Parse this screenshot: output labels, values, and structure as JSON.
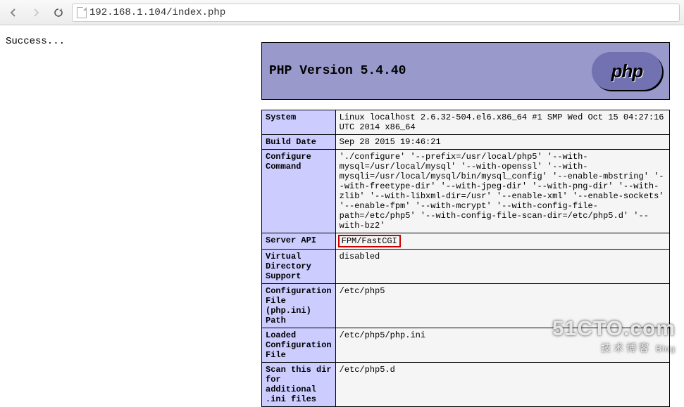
{
  "browser": {
    "url": "192.168.1.104/index.php"
  },
  "page": {
    "success_text": "Success..."
  },
  "phpinfo": {
    "title": "PHP Version 5.4.40",
    "logo_text": "php",
    "rows": [
      {
        "key": "System",
        "value": "Linux localhost 2.6.32-504.el6.x86_64 #1 SMP Wed Oct 15 04:27:16 UTC 2014 x86_64"
      },
      {
        "key": "Build Date",
        "value": "Sep 28 2015 19:46:21"
      },
      {
        "key": "Configure Command",
        "value": "'./configure' '--prefix=/usr/local/php5' '--with-mysql=/usr/local/mysql' '--with-openssl' '--with-mysqli=/usr/local/mysql/bin/mysql_config' '--enable-mbstring' '--with-freetype-dir' '--with-jpeg-dir' '--with-png-dir' '--with-zlib' '--with-libxml-dir=/usr' '--enable-xml' '--enable-sockets' '--enable-fpm' '--with-mcrypt' '--with-config-file-path=/etc/php5' '--with-config-file-scan-dir=/etc/php5.d' '--with-bz2'"
      },
      {
        "key": "Server API",
        "value": "FPM/FastCGI",
        "highlight": true
      },
      {
        "key": "Virtual Directory Support",
        "value": "disabled"
      },
      {
        "key": "Configuration File (php.ini) Path",
        "value": "/etc/php5"
      },
      {
        "key": "Loaded Configuration File",
        "value": "/etc/php5/php.ini"
      },
      {
        "key": "Scan this dir for additional .ini files",
        "value": "/etc/php5.d"
      }
    ]
  },
  "watermark": {
    "line1": "51CTO.com",
    "line2_cn": "技术博客",
    "line2_en": "Blog"
  }
}
